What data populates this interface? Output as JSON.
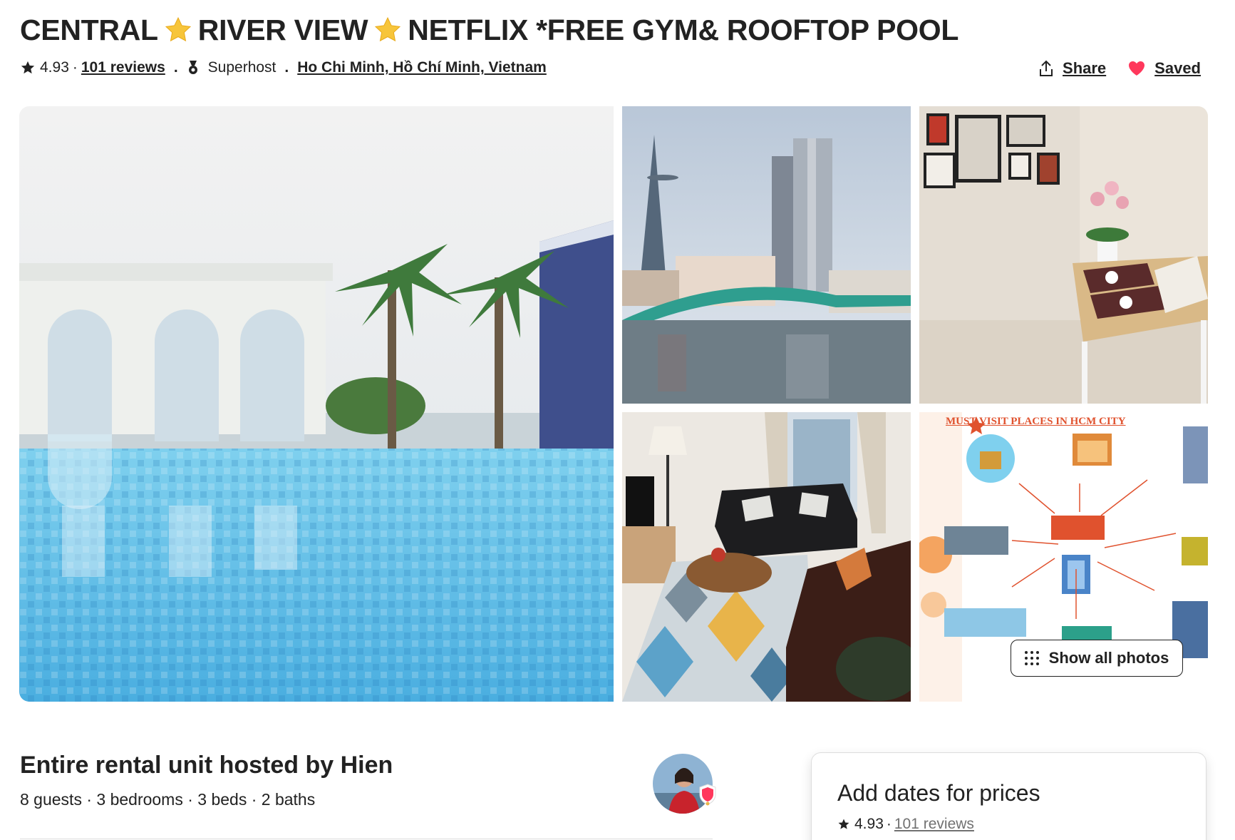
{
  "listing": {
    "title_parts": [
      "CENTRAL",
      "RIVER VIEW",
      "NETFLIX *FREE GYM& ROOFTOP POOL"
    ],
    "title_star_icon": "star-emoji",
    "rating": "4.93",
    "reviews_link": "101 reviews",
    "host_status": "Superhost",
    "location": "Ho Chi Minh, Hồ Chí Minh, Vietnam"
  },
  "actions": {
    "share_label": "Share",
    "saved_label": "Saved"
  },
  "gallery": {
    "photos": [
      "rooftop-pool",
      "river-skyline",
      "dining-area",
      "living-room",
      "city-map"
    ],
    "map_heading": "MUST-VISIT PLACES IN HCM CITY",
    "show_all_label": "Show all photos"
  },
  "host": {
    "title": "Entire rental unit hosted by Hien",
    "details": "8 guests · 3 bedrooms · 3 beds · 2 baths"
  },
  "price_card": {
    "title": "Add dates for prices",
    "rating": "4.93",
    "reviews_link": "101 reviews"
  },
  "colors": {
    "heart": "#ff385c",
    "text": "#222222",
    "muted": "#717171",
    "border": "#dddddd"
  }
}
